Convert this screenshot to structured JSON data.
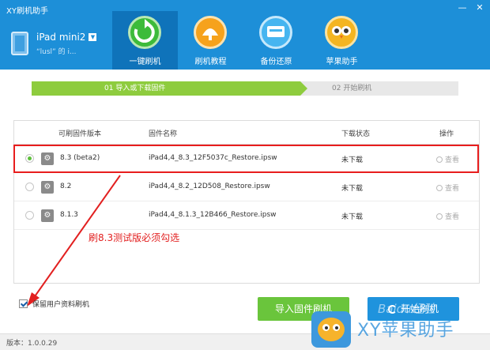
{
  "window": {
    "title": "XY刷机助手",
    "controls": [
      "—",
      "✕"
    ]
  },
  "device": {
    "name": "iPad mini2",
    "subtitle": "“lusl” 的 i..."
  },
  "nav": [
    {
      "label": "一键刷机",
      "active": true
    },
    {
      "label": "刷机教程",
      "active": false
    },
    {
      "label": "备份还原",
      "active": false
    },
    {
      "label": "苹果助手",
      "active": false
    }
  ],
  "steps": {
    "step1": "01  导入或下载固件",
    "step2": "02  开始刷机"
  },
  "table": {
    "headers": {
      "version": "可刷固件版本",
      "name": "固件名称",
      "status": "下载状态",
      "action": "操作"
    },
    "rows": [
      {
        "version": "8.3 (beta2)",
        "file": "iPad4,4_8.3_12F5037c_Restore.ipsw",
        "status": "未下载",
        "action": "查看",
        "selected": true
      },
      {
        "version": "8.2",
        "file": "iPad4,4_8.2_12D508_Restore.ipsw",
        "status": "未下载",
        "action": "查看",
        "selected": false
      },
      {
        "version": "8.1.3",
        "file": "iPad4,4_8.1.3_12B466_Restore.ipsw",
        "status": "未下载",
        "action": "查看",
        "selected": false
      }
    ]
  },
  "annotation": "刷8.3测试版必须勾选",
  "keep_data": {
    "label": "保留用户资料刷机",
    "checked": true
  },
  "buttons": {
    "import": "导入固件刷机",
    "start": "开始刷机"
  },
  "footer": {
    "version": "版本：1.0.0.29"
  },
  "watermark": {
    "text": "XY苹果助手",
    "baidu": "Baidu经验"
  },
  "colors": {
    "header": "#1d8fd8",
    "step_active": "#8ecc3e",
    "highlight": "#e81d1d",
    "import_button": "#6ac53c",
    "start_button": "#1f93dd"
  }
}
